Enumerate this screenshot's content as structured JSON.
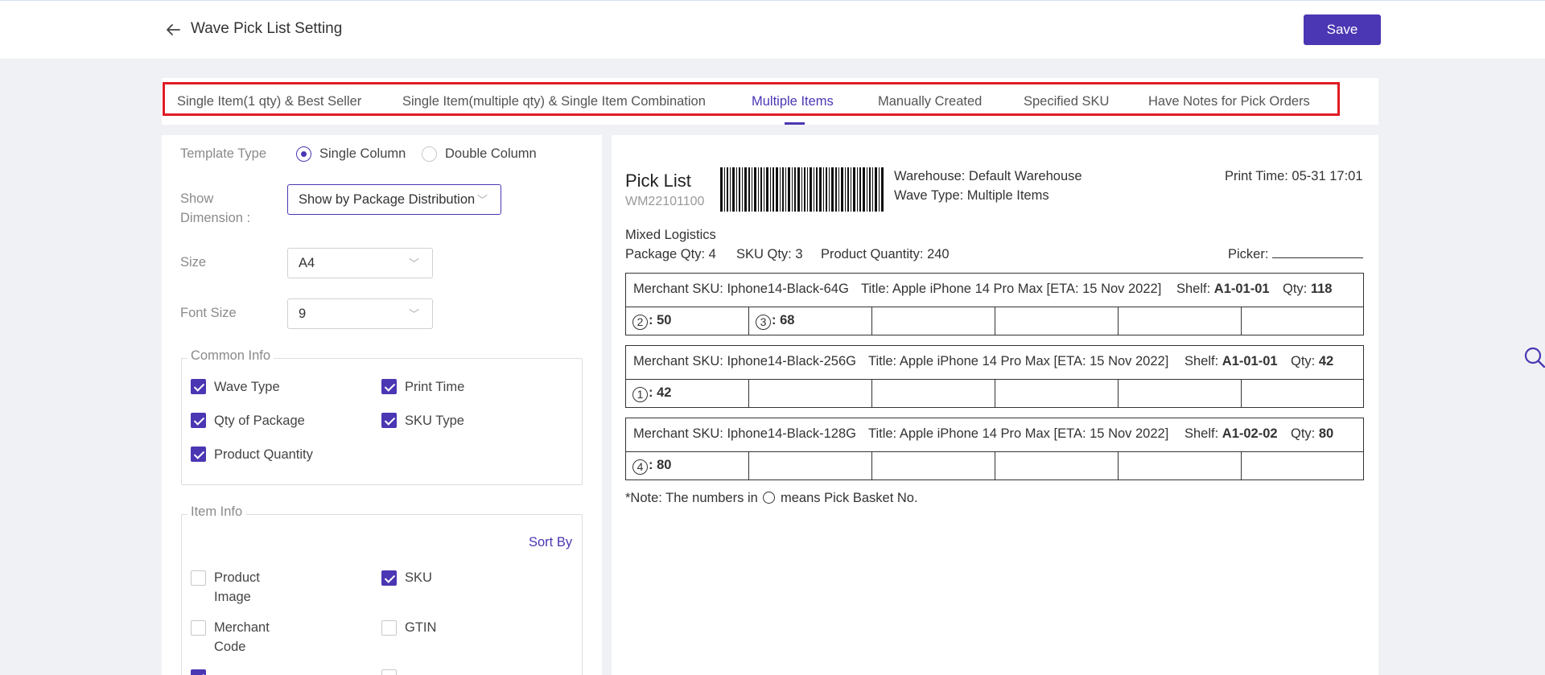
{
  "header": {
    "back_icon": "arrow-left-icon",
    "title": "Wave Pick List Setting",
    "save_label": "Save"
  },
  "tabs": [
    {
      "label": "Single Item(1 qty) & Best Seller",
      "active": false
    },
    {
      "label": "Single Item(multiple qty) & Single Item Combination",
      "active": false
    },
    {
      "label": "Multiple Items",
      "active": true
    },
    {
      "label": "Manually Created",
      "active": false
    },
    {
      "label": "Specified SKU",
      "active": false
    },
    {
      "label": "Have Notes for Pick Orders",
      "active": false
    }
  ],
  "settings": {
    "template_type": {
      "label": "Template Type",
      "options": [
        {
          "label": "Single Column",
          "selected": true
        },
        {
          "label": "Double Column",
          "selected": false
        }
      ]
    },
    "show_dimension": {
      "label_line1": "Show",
      "label_line2": "Dimension :",
      "value": "Show by Package Distribution"
    },
    "size": {
      "label": "Size",
      "value": "A4"
    },
    "font_size": {
      "label": "Font Size",
      "value": "9"
    },
    "common_info": {
      "legend": "Common Info",
      "items": [
        {
          "label": "Wave Type",
          "checked": true
        },
        {
          "label": "Print Time",
          "checked": true
        },
        {
          "label": "Qty of Package",
          "checked": true
        },
        {
          "label": "SKU Type",
          "checked": true
        },
        {
          "label": "Product Quantity",
          "checked": true
        }
      ]
    },
    "item_info": {
      "legend": "Item Info",
      "sort_by": "Sort By",
      "items": [
        {
          "label_line1": "Product",
          "label_line2": "Image",
          "checked": false
        },
        {
          "label_line1": "SKU",
          "label_line2": "",
          "checked": true
        },
        {
          "label_line1": "Merchant",
          "label_line2": "Code",
          "checked": false
        },
        {
          "label_line1": "GTIN",
          "label_line2": "",
          "checked": false
        }
      ]
    }
  },
  "preview": {
    "title": "Pick List",
    "code": "WM22101100",
    "warehouse": "Warehouse: Default Warehouse",
    "wave_type": "Wave Type: Multiple Items",
    "print_time": "Print Time: 05-31 17:01",
    "logistics": "Mixed Logistics",
    "package_qty": "Package Qty: 4",
    "sku_qty": "SKU Qty: 3",
    "product_quantity": "Product Quantity: 240",
    "picker": "Picker:",
    "rows": [
      {
        "merchant_sku": "Merchant SKU: Iphone14-Black-64G",
        "title": "Title: Apple iPhone 14 Pro Max [ETA: 15 Nov 2022]",
        "shelf_label": "Shelf: ",
        "shelf": "A1-01-01",
        "qty_label": "Qty: ",
        "qty": "118",
        "baskets": [
          {
            "no": "2",
            "qty": ": 50"
          },
          {
            "no": "3",
            "qty": ": 68"
          }
        ]
      },
      {
        "merchant_sku": "Merchant SKU: Iphone14-Black-256G",
        "title": "Title: Apple iPhone 14 Pro Max [ETA: 15 Nov 2022]",
        "shelf_label": "Shelf: ",
        "shelf": "A1-01-01",
        "qty_label": "Qty: ",
        "qty": "42",
        "baskets": [
          {
            "no": "1",
            "qty": ": 42"
          }
        ]
      },
      {
        "merchant_sku": "Merchant SKU: Iphone14-Black-128G",
        "title": "Title: Apple iPhone 14 Pro Max [ETA: 15 Nov 2022]",
        "shelf_label": "Shelf: ",
        "shelf": "A1-02-02",
        "qty_label": "Qty: ",
        "qty": "80",
        "baskets": [
          {
            "no": "4",
            "qty": ": 80"
          }
        ]
      }
    ],
    "note_before": "*Note: The numbers in",
    "note_after": "means Pick Basket No."
  },
  "side_search_icon": "search-icon"
}
